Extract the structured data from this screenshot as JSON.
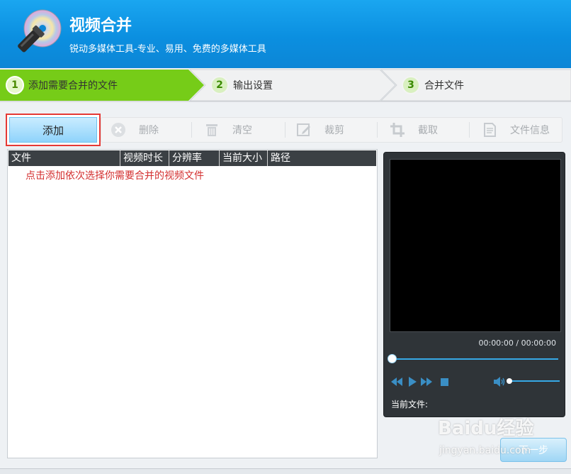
{
  "header": {
    "title": "视频合并",
    "subtitle": "锐动多媒体工具-专业、易用、免费的多媒体工具"
  },
  "steps": [
    {
      "num": "1",
      "label": "添加需要合并的文件",
      "active": true
    },
    {
      "num": "2",
      "label": "输出设置",
      "active": false
    },
    {
      "num": "3",
      "label": "合并文件",
      "active": false
    }
  ],
  "toolbar": {
    "add_label": "添加",
    "delete_label": "删除",
    "clear_label": "清空",
    "crop_label": "裁剪",
    "clip_label": "截取",
    "info_label": "文件信息"
  },
  "table": {
    "columns": [
      "文件",
      "视频时长",
      "分辨率",
      "当前大小",
      "路径"
    ],
    "hint": "点击添加依次选择你需要合并的视频文件"
  },
  "player": {
    "time": "00:00:00 / 00:00:00",
    "current_file_label": "当前文件:"
  },
  "footer": {
    "next_label": "下一步"
  },
  "watermark": {
    "text": "Baidu经验",
    "url": "jingyan.baidu.com"
  },
  "colors": {
    "header_blue": "#0b8fe0",
    "step_active_green": "#6cc712",
    "highlight_red": "#e53935",
    "hint_red": "#d32f2f",
    "player_bg": "#2f3438",
    "accent_blue": "#36a9e6"
  }
}
